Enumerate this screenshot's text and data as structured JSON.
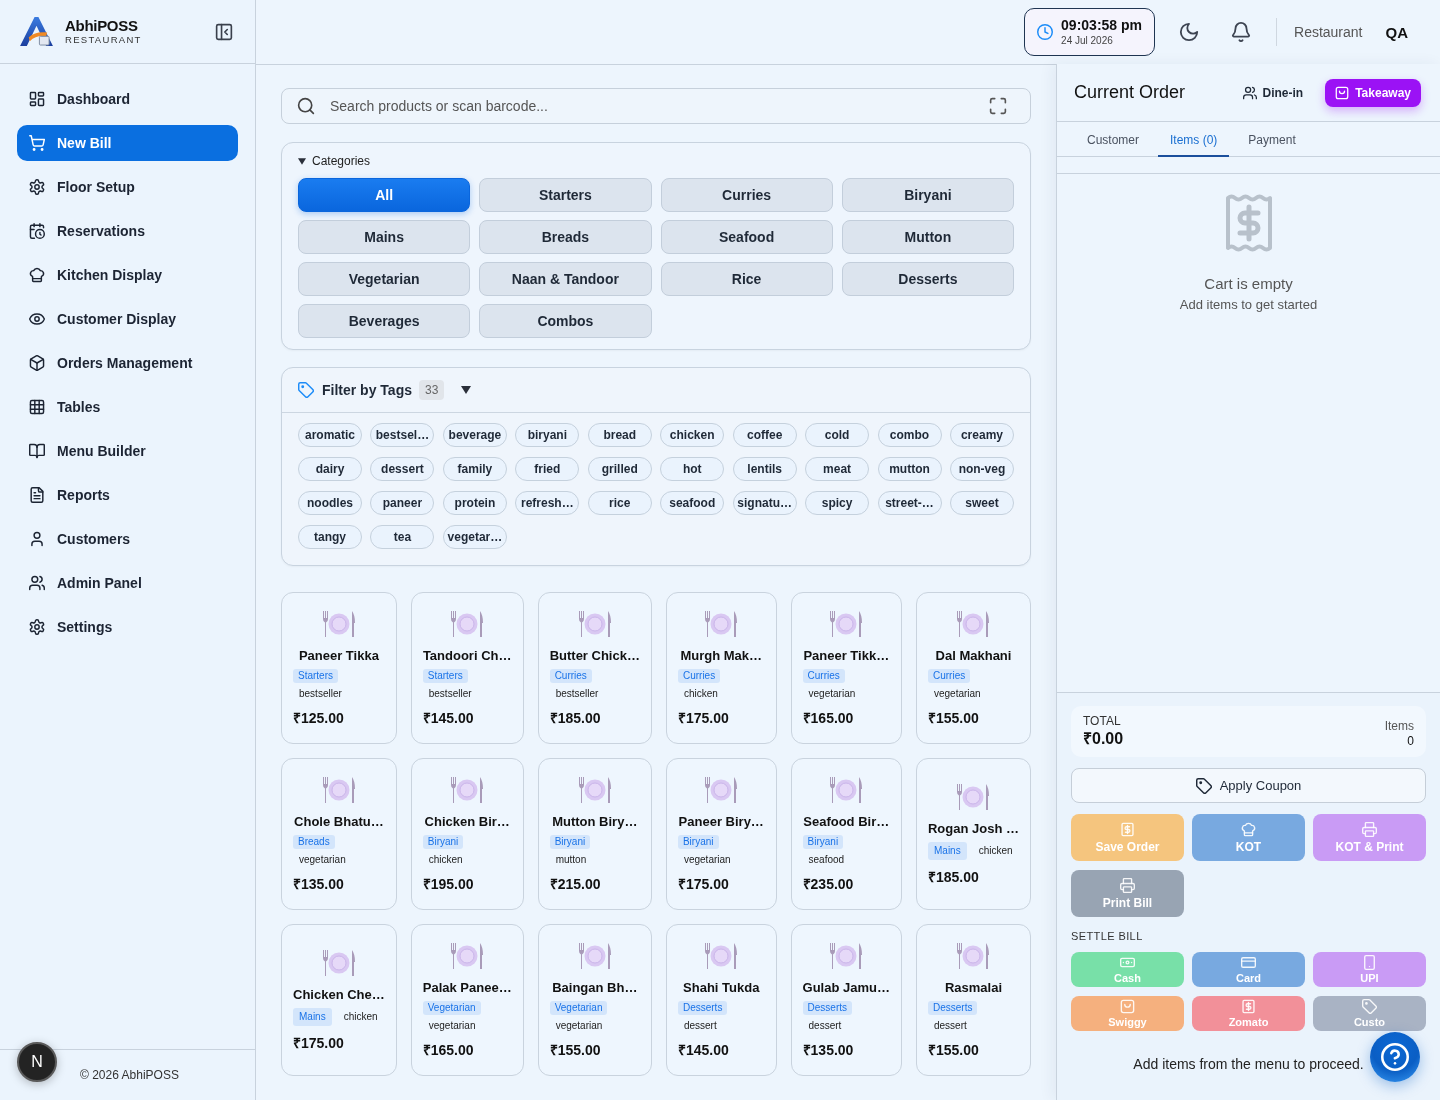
{
  "sidebar": {
    "brand": {
      "name": "AbhiPOSS",
      "subtitle": "RESTAURANT"
    },
    "items": [
      {
        "label": "Dashboard",
        "selected": false
      },
      {
        "label": "New Bill",
        "selected": true
      },
      {
        "label": "Floor Setup",
        "selected": false
      },
      {
        "label": "Reservations",
        "selected": false
      },
      {
        "label": "Kitchen Display",
        "selected": false
      },
      {
        "label": "Customer Display",
        "selected": false
      },
      {
        "label": "Orders Management",
        "selected": false
      },
      {
        "label": "Tables",
        "selected": false
      },
      {
        "label": "Menu Builder",
        "selected": false
      },
      {
        "label": "Reports",
        "selected": false
      },
      {
        "label": "Customers",
        "selected": false
      },
      {
        "label": "Admin Panel",
        "selected": false
      },
      {
        "label": "Settings",
        "selected": false
      }
    ],
    "footer": "© 2026 AbhiPOSS",
    "avatar": "N"
  },
  "header": {
    "clock": {
      "time": "09:03:58 pm",
      "date": "24 Jul 2026"
    },
    "context": "Restaurant",
    "user": "QA"
  },
  "search": {
    "placeholder": "Search products or scan barcode..."
  },
  "categories": {
    "title": "Categories",
    "expanded": true,
    "items": [
      {
        "label": "All",
        "selected": true
      },
      {
        "label": "Starters",
        "selected": false
      },
      {
        "label": "Curries",
        "selected": false
      },
      {
        "label": "Biryani",
        "selected": false
      },
      {
        "label": "Mains",
        "selected": false
      },
      {
        "label": "Breads",
        "selected": false
      },
      {
        "label": "Seafood",
        "selected": false
      },
      {
        "label": "Mutton",
        "selected": false
      },
      {
        "label": "Vegetarian",
        "selected": false
      },
      {
        "label": "Naan & Tandoor",
        "selected": false
      },
      {
        "label": "Rice",
        "selected": false
      },
      {
        "label": "Desserts",
        "selected": false
      },
      {
        "label": "Beverages",
        "selected": false
      },
      {
        "label": "Combos",
        "selected": false
      }
    ]
  },
  "tag_filter": {
    "title": "Filter by Tags",
    "count": "33",
    "expanded": true,
    "tags": [
      "aromatic",
      "bestsel…",
      "beverage",
      "biryani",
      "bread",
      "chicken",
      "coffee",
      "cold",
      "combo",
      "creamy",
      "dairy",
      "dessert",
      "family",
      "fried",
      "grilled",
      "hot",
      "lentils",
      "meat",
      "mutton",
      "non-veg",
      "noodles",
      "paneer",
      "protein",
      "refresh…",
      "rice",
      "seafood",
      "signatu…",
      "spicy",
      "street-…",
      "sweet",
      "tangy",
      "tea",
      "vegetar…"
    ]
  },
  "products": [
    {
      "kind": "stacked",
      "name": "Paneer Tikka",
      "category": "Starters",
      "tag": "bestseller",
      "price": "₹125.00"
    },
    {
      "kind": "stacked",
      "name": "Tandoori Ch…",
      "category": "Starters",
      "tag": "bestseller",
      "price": "₹145.00"
    },
    {
      "kind": "stacked",
      "name": "Butter Chick…",
      "category": "Curries",
      "tag": "bestseller",
      "price": "₹185.00"
    },
    {
      "kind": "stacked",
      "name": "Murgh Mak…",
      "category": "Curries",
      "tag": "chicken",
      "price": "₹175.00"
    },
    {
      "kind": "stacked",
      "name": "Paneer Tikk…",
      "category": "Curries",
      "tag": "vegetarian",
      "price": "₹165.00"
    },
    {
      "kind": "stacked",
      "name": "Dal Makhani",
      "category": "Curries",
      "tag": "vegetarian",
      "price": "₹155.00"
    },
    {
      "kind": "stacked",
      "name": "Chole Bhatu…",
      "category": "Breads",
      "tag": "vegetarian",
      "price": "₹135.00"
    },
    {
      "kind": "stacked",
      "name": "Chicken Bir…",
      "category": "Biryani",
      "tag": "chicken",
      "price": "₹195.00"
    },
    {
      "kind": "stacked",
      "name": "Mutton Biry…",
      "category": "Biryani",
      "tag": "mutton",
      "price": "₹215.00"
    },
    {
      "kind": "stacked",
      "name": "Paneer Biry…",
      "category": "Biryani",
      "tag": "vegetarian",
      "price": "₹175.00"
    },
    {
      "kind": "stacked",
      "name": "Seafood Bir…",
      "category": "Biryani",
      "tag": "seafood",
      "price": "₹235.00"
    },
    {
      "kind": "inline",
      "name": "Rogan Josh …",
      "category": "Mains",
      "tag": "chicken",
      "price": "₹185.00"
    },
    {
      "kind": "inline",
      "name": "Chicken Che…",
      "category": "Mains",
      "tag": "chicken",
      "price": "₹175.00"
    },
    {
      "kind": "stacked",
      "name": "Palak Panee…",
      "category": "Vegetarian",
      "tag": "vegetarian",
      "price": "₹165.00"
    },
    {
      "kind": "stacked",
      "name": "Baingan Bh…",
      "category": "Vegetarian",
      "tag": "vegetarian",
      "price": "₹155.00"
    },
    {
      "kind": "stacked",
      "name": "Shahi Tukda",
      "category": "Desserts",
      "tag": "dessert",
      "price": "₹145.00"
    },
    {
      "kind": "stacked",
      "name": "Gulab Jamu…",
      "category": "Desserts",
      "tag": "dessert",
      "price": "₹135.00"
    },
    {
      "kind": "stacked",
      "name": "Rasmalai",
      "category": "Desserts",
      "tag": "dessert",
      "price": "₹155.00"
    }
  ],
  "order": {
    "title": "Current Order",
    "modes": [
      {
        "label": "Dine-in",
        "selected": false
      },
      {
        "label": "Takeaway",
        "selected": true
      }
    ],
    "tabs": [
      {
        "label": "Customer",
        "selected": false
      },
      {
        "label": "Items (0)",
        "selected": true
      },
      {
        "label": "Payment",
        "selected": false
      }
    ],
    "empty": {
      "title": "Cart is empty",
      "hint": "Add items to get started"
    },
    "total": {
      "label": "TOTAL",
      "amount": "₹0.00",
      "items_label": "Items",
      "items_count": "0"
    },
    "coupon": "Apply Coupon",
    "actions": [
      {
        "label": "Save Order",
        "color": "#f5c57e"
      },
      {
        "label": "KOT",
        "color": "#78a9e0"
      },
      {
        "label": "KOT & Print",
        "color": "#c99bf5"
      },
      {
        "label": "Print Bill",
        "color": "#98a4b3"
      }
    ],
    "settle_label": "SETTLE BILL",
    "payments": [
      {
        "label": "Cash",
        "color": "#78e0a8"
      },
      {
        "label": "Card",
        "color": "#78a9e0"
      },
      {
        "label": "UPI",
        "color": "#c99bf5"
      },
      {
        "label": "Swiggy",
        "color": "#f5b07e"
      },
      {
        "label": "Zomato",
        "color": "#f29099"
      },
      {
        "label": "Custo",
        "color": "#a9b3c4"
      }
    ],
    "hint": "Add items from the menu to proceed."
  }
}
